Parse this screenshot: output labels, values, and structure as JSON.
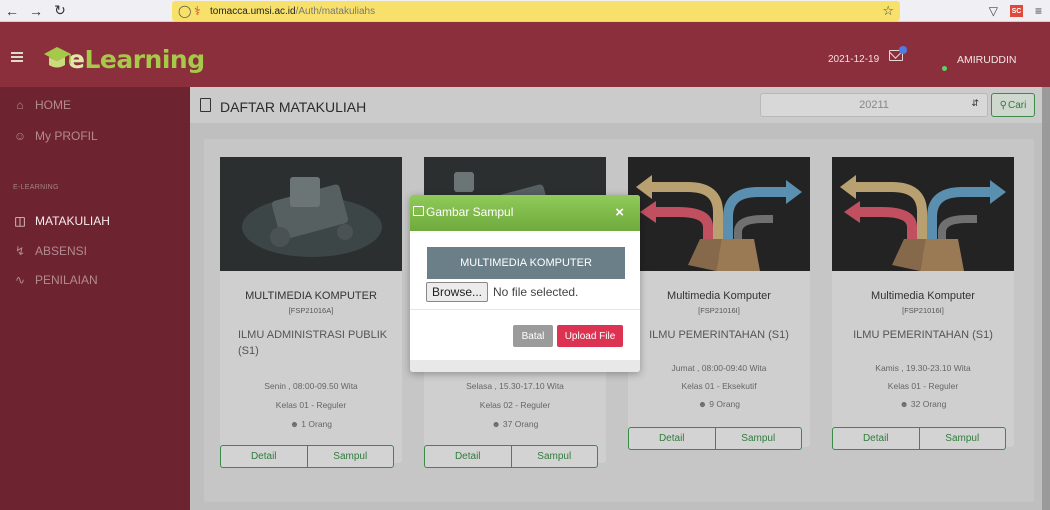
{
  "browser": {
    "url_domain": "tomacca.umsi.ac.id",
    "url_path": "/Auth/matakuliahs",
    "icons": [
      "back-icon",
      "forward-icon",
      "reload-icon",
      "shield-icon",
      "lock-icon",
      "star-icon",
      "pocket-icon",
      "menu-icon"
    ],
    "extension_badge": "SC"
  },
  "header": {
    "logo_e": "e",
    "logo_rest": "Learning",
    "date": "2021-12-19",
    "user": "AMIRUDDIN"
  },
  "sidebar": {
    "section_label": "E-LEARNING",
    "items": [
      {
        "label": "HOME",
        "icon": "home-icon",
        "active": false
      },
      {
        "label": "My PROFIL",
        "icon": "user-icon",
        "active": false
      },
      {
        "label": "MATAKULIAH",
        "icon": "file-icon",
        "active": true
      },
      {
        "label": "ABSENSI",
        "icon": "lightning-icon",
        "active": false
      },
      {
        "label": "PENILAIAN",
        "icon": "pulse-icon",
        "active": false
      }
    ]
  },
  "content": {
    "title": "DAFTAR MATAKULIAH",
    "semester_value": "20211",
    "cari_label": "Cari"
  },
  "cards": [
    {
      "title": "MULTIMEDIA KOMPUTER",
      "code": "[FSP21016A]",
      "program": "ILMU ADMINISTRASI PUBLIK (S1)",
      "schedule": "Senin , 08:00-09.50 Wita",
      "class": "Kelas 01 - Reguler",
      "students": "1 Orang",
      "detail": "Detail",
      "sampul": "Sampul"
    },
    {
      "title": "",
      "code": "",
      "program": "",
      "schedule": "Selasa , 15.30-17.10 Wita",
      "class": "Kelas 02 - Reguler",
      "students": "37 Orang",
      "detail": "Detail",
      "sampul": "Sampul"
    },
    {
      "title": "Multimedia Komputer",
      "code": "[FSP21016I]",
      "program": "ILMU PEMERINTAHAN (S1)",
      "schedule": "Jumat , 08:00-09:40 Wita",
      "class": "Kelas 01 - Eksekutif",
      "students": "9 Orang",
      "detail": "Detail",
      "sampul": "Sampul"
    },
    {
      "title": "Multimedia Komputer",
      "code": "[FSP21016I]",
      "program": "ILMU PEMERINTAHAN (S1)",
      "schedule": "Kamis , 19.30-23.10 Wita",
      "class": "Kelas 01 - Reguler",
      "students": "32 Orang",
      "detail": "Detail",
      "sampul": "Sampul"
    }
  ],
  "modal": {
    "title": "Gambar Sampul",
    "close": "×",
    "preview_text": "MULTIMEDIA KOMPUTER",
    "browse_label": "Browse...",
    "file_status": "No file selected.",
    "batal_label": "Batal",
    "upload_label": "Upload File"
  },
  "colors": {
    "header": "#8c2f3c",
    "sidebar": "#6e2430",
    "modal_header": "#7ab648",
    "upload": "#dc3352",
    "accent_green": "#3a8a48"
  }
}
